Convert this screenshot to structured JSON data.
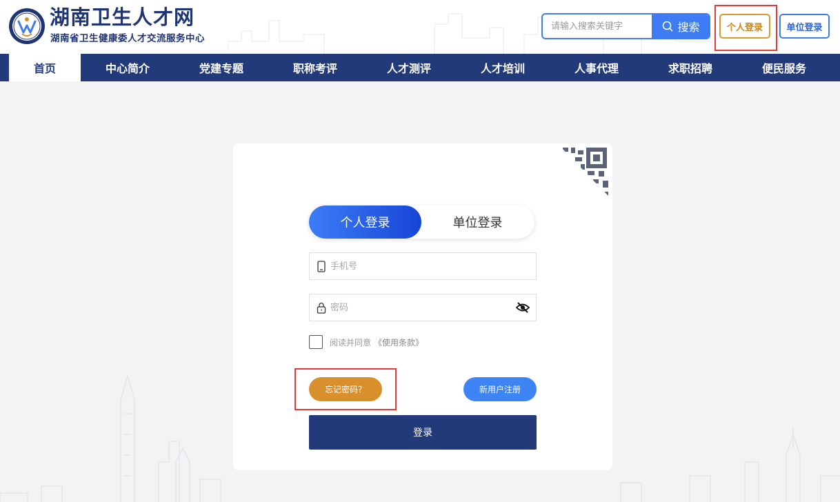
{
  "header": {
    "title": "湖南卫生人才网",
    "subtitle": "湖南省卫生健康委人才交流服务中心",
    "search_placeholder": "请输入搜索关键字",
    "search_label": "搜索",
    "personal_login": "个人登录",
    "unit_login": "单位登录"
  },
  "nav": {
    "items": [
      "首页",
      "中心简介",
      "党建专题",
      "职称考评",
      "人才测评",
      "人才培训",
      "人事代理",
      "求职招聘",
      "便民服务"
    ],
    "active_index": 0
  },
  "login": {
    "tabs": [
      "个人登录",
      "单位登录"
    ],
    "active_tab": 0,
    "phone_placeholder": "手机号",
    "password_placeholder": "密码",
    "agree_text": "阅读并同意",
    "terms_link": "《使用条款》",
    "forgot_password": "忘记密码？",
    "register": "新用户注册",
    "submit": "登录"
  },
  "colors": {
    "brand_navy": "#233a7a",
    "accent_blue": "#3d7cf3",
    "accent_gold": "#d8902c",
    "highlight_red": "#e53935"
  },
  "icons": {
    "logo": "circular-emblem",
    "search": "search-icon",
    "phone": "phone-icon",
    "lock": "lock-icon",
    "eye": "eye-off-icon",
    "qr": "qr-code-corner-icon"
  }
}
